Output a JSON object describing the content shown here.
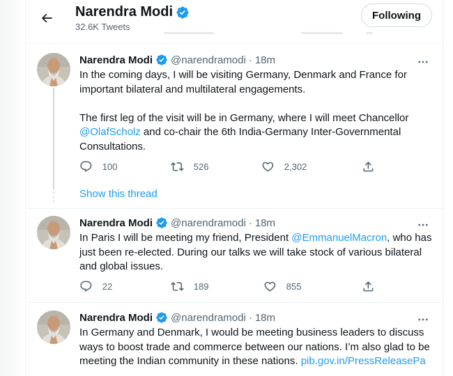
{
  "header": {
    "name": "Narendra Modi",
    "tweet_count": "32.6K Tweets",
    "follow_label": "Following"
  },
  "tweets": [
    {
      "name": "Narendra Modi",
      "handle": "@narendramodi",
      "separator": "·",
      "time": "18m",
      "text_before": "In the coming days, I will be visiting Germany, Denmark and France for important bilateral and multilateral engagements.\n\nThe first leg of the visit will be in Germany, where I will meet Chancellor ",
      "mention": "@OlafScholz",
      "text_after": " and co-chair the 6th India-Germany Inter-Governmental Consultations.",
      "replies": "100",
      "retweets": "526",
      "likes": "2,302"
    },
    {
      "name": "Narendra Modi",
      "handle": "@narendramodi",
      "separator": "·",
      "time": "18m",
      "text_before": "In Paris I will be meeting my friend, President ",
      "mention": "@EmmanuelMacron",
      "text_after": ", who has just been re-elected. During our talks we will take stock of various bilateral and global issues.",
      "replies": "22",
      "retweets": "189",
      "likes": "855"
    },
    {
      "name": "Narendra Modi",
      "handle": "@narendramodi",
      "separator": "·",
      "time": "18m",
      "text_before": "In Germany and Denmark, I would be meeting business leaders to discuss ways to boost trade and commerce between our nations. I’m also glad to be meeting the Indian community in these nations. ",
      "mention": "pib.gov.in/PressReleasePa",
      "text_after": ""
    }
  ],
  "show_thread_label": "Show this thread",
  "icons": {
    "back": "back-arrow-icon",
    "verified": "verified-badge-icon",
    "more": "more-options-icon",
    "reply": "reply-icon",
    "retweet": "retweet-icon",
    "like": "like-icon",
    "share": "share-icon"
  },
  "colors": {
    "accent": "#1d9bf0",
    "text": "#0f1419",
    "secondary": "#536471",
    "border": "#cfd9de"
  }
}
